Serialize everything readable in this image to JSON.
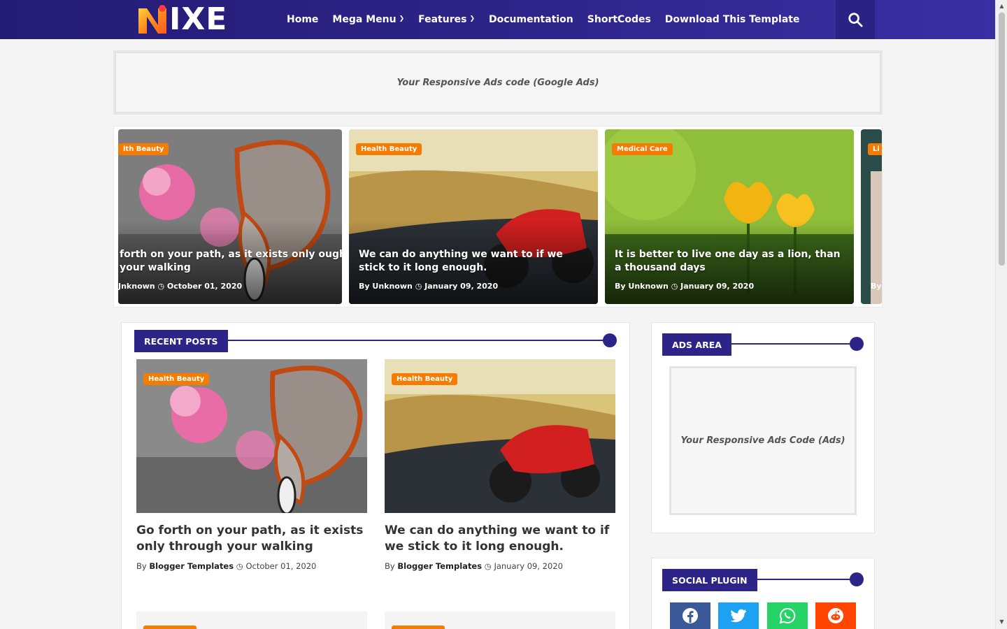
{
  "header": {
    "logo_text": "IXE",
    "nav": [
      {
        "label": "Home",
        "has_dropdown": false
      },
      {
        "label": "Mega Menu",
        "has_dropdown": true
      },
      {
        "label": "Features",
        "has_dropdown": true
      },
      {
        "label": "Documentation",
        "has_dropdown": false
      },
      {
        "label": "ShortCodes",
        "has_dropdown": false
      },
      {
        "label": "Download This Template",
        "has_dropdown": false
      }
    ],
    "search_icon": "search-icon"
  },
  "top_ad": {
    "text": "Your Responsive Ads code (Google Ads)"
  },
  "slider": [
    {
      "badge": "lth Beauty",
      "title": "forth on your path, as it exists only ough your walking",
      "meta_by": "Jnknown",
      "date": "October 01, 2020"
    },
    {
      "badge": "Health Beauty",
      "title": "We can do anything we want to if we stick to it long enough.",
      "meta_by": "By Unknown",
      "date": "January 09, 2020"
    },
    {
      "badge": "Medical Care",
      "title": "It is better to live one day as a lion, than a thousand days",
      "meta_by": "By Unknown",
      "date": "January 09, 2020"
    },
    {
      "badge": "Li",
      "meta_by": "By"
    }
  ],
  "recent": {
    "heading": "RECENT POSTS",
    "posts": [
      {
        "badge": "Health Beauty",
        "title": "Go forth on your path, as it exists only through your walking",
        "by_label": "By",
        "author": "Blogger Templates",
        "date": "October 01, 2020"
      },
      {
        "badge": "Health Beauty",
        "title": "We can do anything we want to if we stick to it long enough.",
        "by_label": "By",
        "author": "Blogger Templates",
        "date": "January 09, 2020"
      }
    ]
  },
  "sidebar": {
    "ads_heading": "ADS AREA",
    "ads_text": "Your Responsive Ads Code (Ads)",
    "social_heading": "SOCIAL PLUGIN",
    "social": [
      {
        "name": "facebook",
        "color": "#3b5998"
      },
      {
        "name": "twitter",
        "color": "#1da1f2"
      },
      {
        "name": "whatsapp",
        "color": "#25d366"
      },
      {
        "name": "reddit",
        "color": "#ff4500"
      }
    ]
  },
  "colors": {
    "primary": "#2d2488",
    "accent": "#f57c00"
  }
}
